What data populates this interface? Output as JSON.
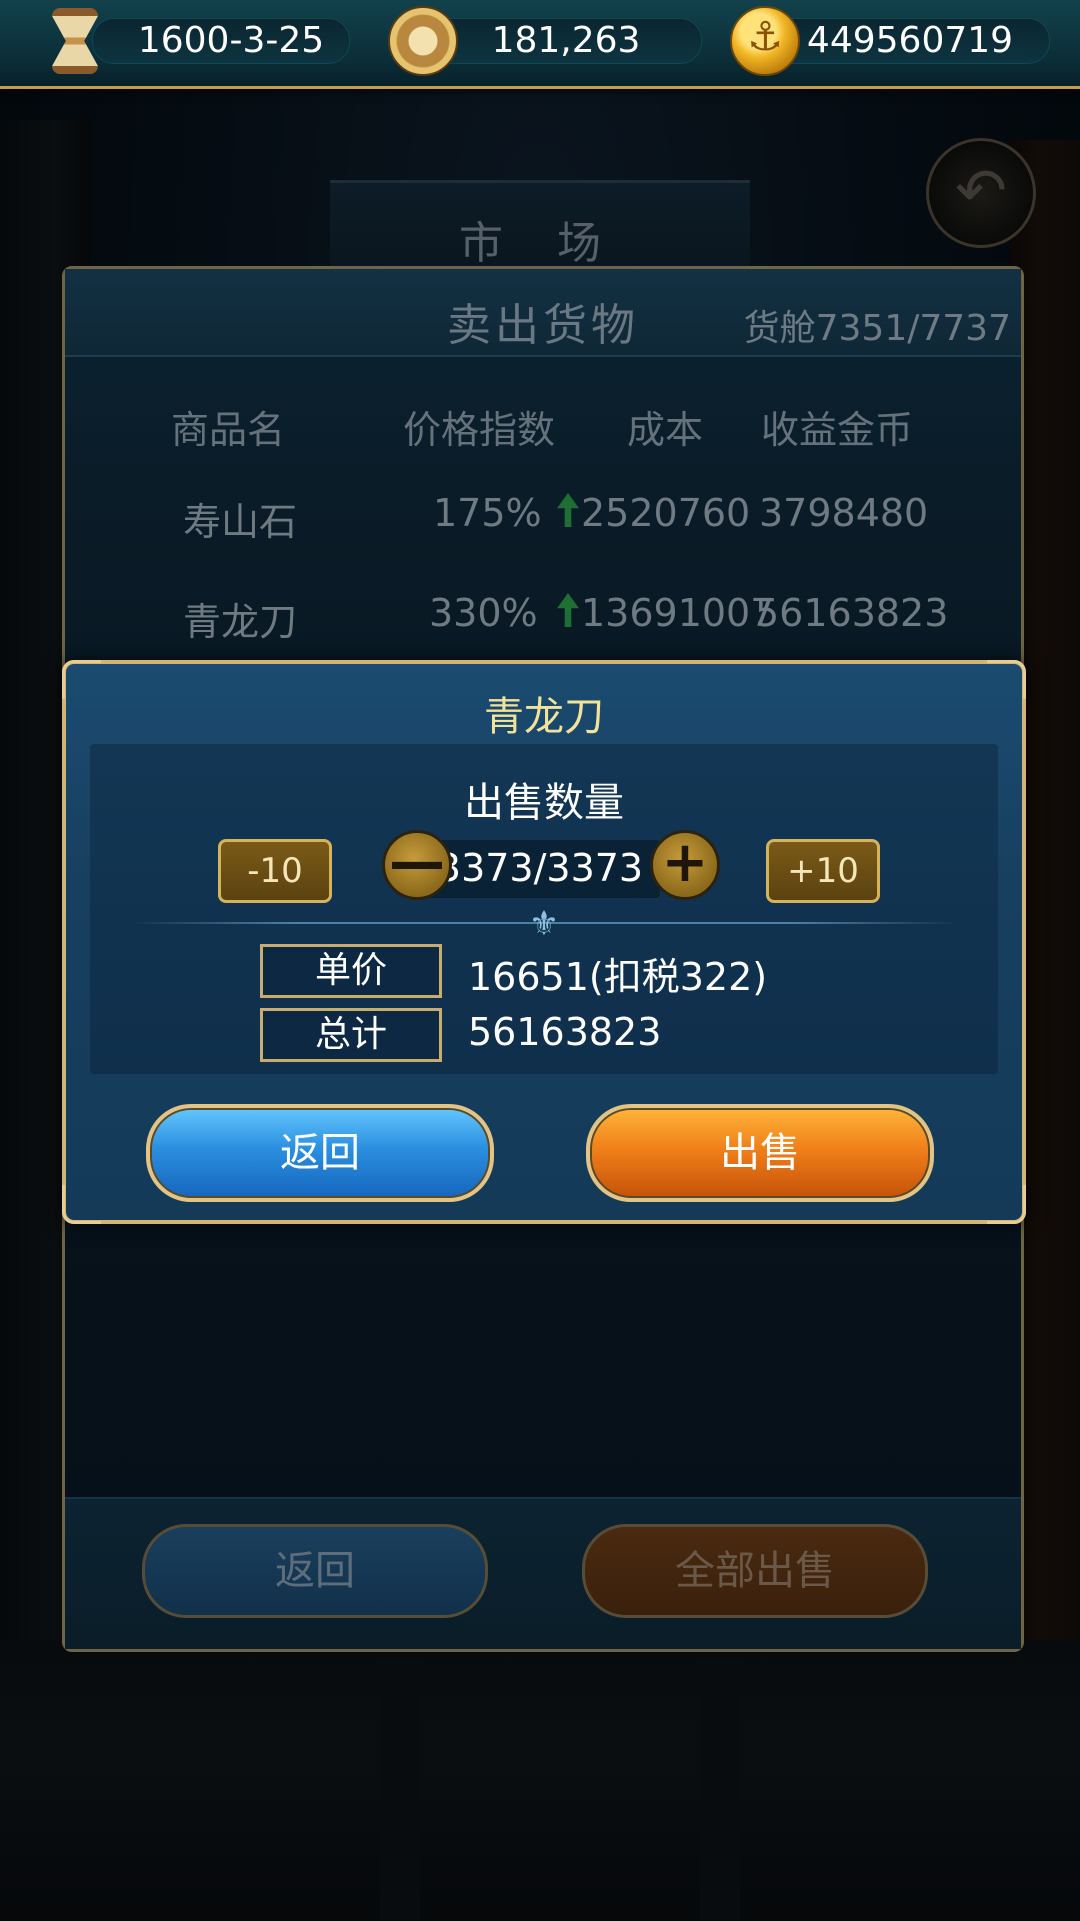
{
  "topbar": {
    "date": "1600-3-25",
    "compass_value": "181,263",
    "gold": "449560719",
    "icons": [
      "hourglass-icon",
      "compass-icon",
      "anchor-coin-icon"
    ]
  },
  "market": {
    "title": "市 场"
  },
  "sell_panel": {
    "title": "卖出货物",
    "cargo": "货舱7351/7737",
    "columns": [
      "商品名",
      "价格指数",
      "成本",
      "收益金币"
    ],
    "rows": [
      {
        "name": "寿山石",
        "price_index": "175%",
        "cost": "2520760",
        "revenue": "3798480"
      },
      {
        "name": "青龙刀",
        "price_index": "330%",
        "cost": "13691007",
        "revenue": "56163823"
      }
    ],
    "back_label": "返回",
    "sell_all_label": "全部出售"
  },
  "modal": {
    "title": "青龙刀",
    "quantity_label": "出售数量",
    "minus10": "-10",
    "plus10": "+10",
    "minus": "—",
    "plus": "+",
    "quantity": "3373/3373",
    "unit_price_label": "单价",
    "unit_price_value": "16651(扣税322)",
    "total_label": "总计",
    "total_value": "56163823",
    "back_label": "返回",
    "sell_label": "出售"
  },
  "colors": {
    "accent_gold": "#d2b477",
    "modal_title": "#f2e39a",
    "back_button": "#2b8fe0",
    "sell_button": "#f0801a"
  }
}
